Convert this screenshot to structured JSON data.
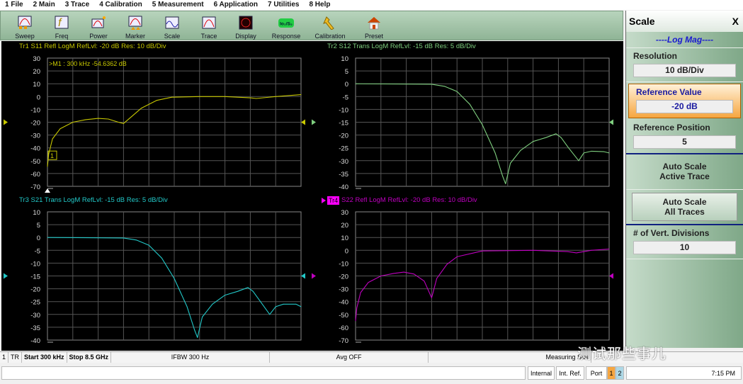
{
  "menu": [
    "1 File",
    "2 Main",
    "3 Trace",
    "4 Calibration",
    "5 Measurement",
    "6 Application",
    "7 Utilities",
    "8 Help"
  ],
  "toolbar": [
    {
      "label": "Sweep",
      "icon": "sweep-icon"
    },
    {
      "label": "Freq",
      "icon": "freq-icon"
    },
    {
      "label": "Power",
      "icon": "power-icon"
    },
    {
      "label": "Marker",
      "icon": "marker-icon"
    },
    {
      "label": "Scale",
      "icon": "scale-icon"
    },
    {
      "label": "Trace",
      "icon": "trace-icon"
    },
    {
      "label": "Display",
      "icon": "display-icon"
    },
    {
      "label": "Response",
      "icon": "response-icon",
      "badge": "lo₂/S₃"
    },
    {
      "label": "Calibration",
      "icon": "wrench-icon"
    },
    {
      "label": "Preset",
      "icon": "house-icon"
    }
  ],
  "panel": {
    "title": "Scale",
    "close": "X",
    "mode": "----Log Mag----",
    "resolution_label": "Resolution",
    "resolution": "10  dB/Div",
    "refval_label": "Reference Value",
    "refval": "-20  dB",
    "refpos_label": "Reference Position",
    "refpos": "5",
    "auto_active": [
      "Auto Scale",
      "Active Trace"
    ],
    "auto_all": [
      "Auto Scale",
      "All Traces"
    ],
    "vdiv_label": "# of Vert. Divisions",
    "vdiv": "10",
    "accent": "#f6a640"
  },
  "status1": {
    "ch": "1",
    "tr": "TR",
    "start": "Start 300 kHz",
    "stop": "Stop 8.5 GHz",
    "ifbw": "IFBW 300 Hz",
    "avg": "Avg OFF",
    "meas": "Measuring Stat"
  },
  "status2": {
    "internal": "Internal",
    "intref": "Int. Ref.",
    "port": "Port",
    "p1": "1",
    "p2": "2",
    "time": "7:15 PM"
  },
  "watermark": "测试那些事儿",
  "chart_data": [
    {
      "type": "line",
      "title": "Tr1  S11 Refl LogM RefLvl: -20  dB Res: 10  dB/Div",
      "color": "#c8c800",
      "xlim": [
        0.0003,
        8.5
      ],
      "ylim": [
        -70,
        30
      ],
      "yticks": [
        30,
        20,
        10,
        0,
        -10,
        -20,
        -30,
        -40,
        -50,
        -60,
        -70
      ],
      "ref": -20,
      "grid": true,
      "marker": {
        "label": "1",
        "readout": ">M1 :   300 kHz  -54.6362  dB",
        "x": 0.0003,
        "y": -54.6362
      },
      "x": [
        0.0003,
        0.04,
        0.17,
        0.43,
        0.85,
        1.28,
        1.7,
        2.04,
        2.38,
        2.55,
        2.8,
        3.15,
        3.66,
        4.17,
        5.1,
        5.95,
        6.8,
        7.0,
        7.65,
        8.5
      ],
      "y": [
        -54.6,
        -45,
        -33,
        -25,
        -20,
        -18,
        -17,
        -17.5,
        -20,
        -21,
        -16,
        -9,
        -3,
        -0.5,
        0,
        0,
        -1,
        -1.5,
        0,
        1.5
      ]
    },
    {
      "type": "line",
      "title": "Tr2  S12 Trans LogM RefLvl: -15  dB Res: 5  dB/Div",
      "color": "#7fcf7f",
      "xlim": [
        0.0003,
        8.5
      ],
      "ylim": [
        -40,
        10
      ],
      "yticks": [
        10,
        5,
        0,
        -5,
        -10,
        -15,
        -20,
        -25,
        -30,
        -35,
        -40
      ],
      "ref": -15,
      "grid": true,
      "x": [
        0.0003,
        2.55,
        2.98,
        3.4,
        3.83,
        4.25,
        4.68,
        4.93,
        5.03,
        5.19,
        5.53,
        5.95,
        6.38,
        6.72,
        6.89,
        7.14,
        7.48,
        7.65,
        7.91,
        8.33,
        8.5
      ],
      "y": [
        0,
        -0.2,
        -1,
        -3,
        -8,
        -16,
        -27,
        -36,
        -39,
        -31,
        -26,
        -22.5,
        -21,
        -19.5,
        -21,
        -25,
        -30,
        -27,
        -26.3,
        -26.5,
        -27
      ]
    },
    {
      "type": "line",
      "title": "Tr3  S21 Trans LogM RefLvl: -15  dB Res: 5  dB/Div",
      "color": "#22c8c8",
      "xlim": [
        0.0003,
        8.5
      ],
      "ylim": [
        -40,
        10
      ],
      "yticks": [
        10,
        5,
        0,
        -5,
        -10,
        -15,
        -20,
        -25,
        -30,
        -35,
        -40
      ],
      "ref": -15,
      "grid": true,
      "x": [
        0.0003,
        2.55,
        2.98,
        3.4,
        3.83,
        4.25,
        4.68,
        4.93,
        5.03,
        5.19,
        5.53,
        5.95,
        6.38,
        6.72,
        6.89,
        7.14,
        7.45,
        7.65,
        7.91,
        8.33,
        8.5
      ],
      "y": [
        0,
        -0.2,
        -1,
        -3,
        -8,
        -16,
        -27,
        -36,
        -39,
        -31,
        -26,
        -22.5,
        -21,
        -19.5,
        -21,
        -25,
        -30,
        -27,
        -26,
        -26,
        -27
      ]
    },
    {
      "type": "line",
      "title": "S22 Refl LogM RefLvl: -20  dB Res: 10  dB/Div",
      "trace_label": "Tr4",
      "color": "#c000c0",
      "xlim": [
        0.0003,
        8.5
      ],
      "ylim": [
        -70,
        30
      ],
      "yticks": [
        30,
        20,
        10,
        0,
        -10,
        -20,
        -30,
        -40,
        -50,
        -60,
        -70
      ],
      "ref": -20,
      "grid": true,
      "x": [
        0.0003,
        0.04,
        0.17,
        0.43,
        0.85,
        1.28,
        1.62,
        1.96,
        2.3,
        2.55,
        2.72,
        3.06,
        3.4,
        4.25,
        5.95,
        7.1,
        7.4,
        7.9,
        8.5
      ],
      "y": [
        -55,
        -45,
        -33,
        -25,
        -20,
        -18,
        -17,
        -18.5,
        -24,
        -37,
        -22,
        -11,
        -5,
        -0.5,
        0,
        -1,
        -2,
        0,
        1
      ]
    }
  ]
}
